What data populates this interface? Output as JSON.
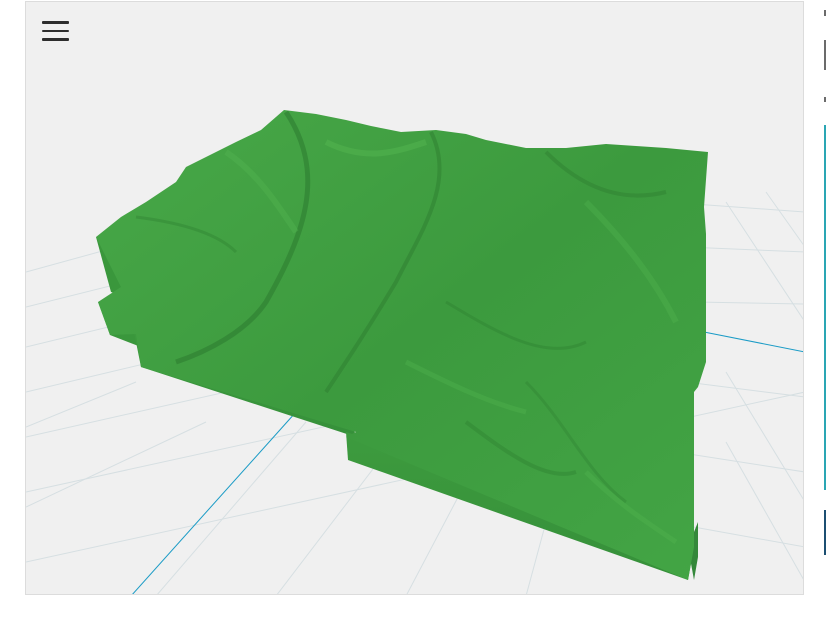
{
  "viewer": {
    "menu_icon": "hamburger-menu-icon",
    "background_color": "#f0f0f0",
    "grid_color": "#d4dde0",
    "axis_color": "#1a9bc6",
    "terrain_color": "#3d9c3f",
    "terrain_shade_color": "#2f7f32",
    "terrain_highlight_color": "#55b64f"
  },
  "side_panel": {
    "frame_color": "#2aa6b4",
    "block_color": "#1c4f72"
  }
}
